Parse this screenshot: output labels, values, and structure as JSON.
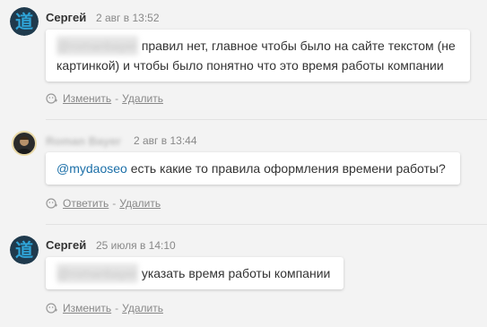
{
  "comments": [
    {
      "author": "Сергей",
      "date": "2 авг в 13:52",
      "mention": "@romanbayer",
      "text_line1": "правил нет, главное чтобы было на сайте текстом (не",
      "text_line2": "картинкой) и чтобы было понятно что это время работы компании",
      "action1": "Изменить",
      "separator": "-",
      "action2": "Удалить",
      "avatar_icon": "dao-character-avatar"
    },
    {
      "author": "Roman Bayer",
      "date": "2 авг в 13:44",
      "mention": "@mydaoseo",
      "text": "есть какие то правила оформления времени работы?",
      "action1": "Ответить",
      "separator": "-",
      "action2": "Удалить",
      "avatar_icon": "person-photo-avatar"
    },
    {
      "author": "Сергей",
      "date": "25 июля в 14:10",
      "mention": "@romanbayer",
      "text": "указать время работы компании",
      "action1": "Изменить",
      "separator": "-",
      "action2": "Удалить",
      "avatar_icon": "dao-character-avatar"
    }
  ],
  "colors": {
    "background": "#f3f3f3",
    "mention_link": "#1b6fa8",
    "avatar_bg": "#1f3a4d",
    "avatar_glyph": "#2fa3d6"
  }
}
